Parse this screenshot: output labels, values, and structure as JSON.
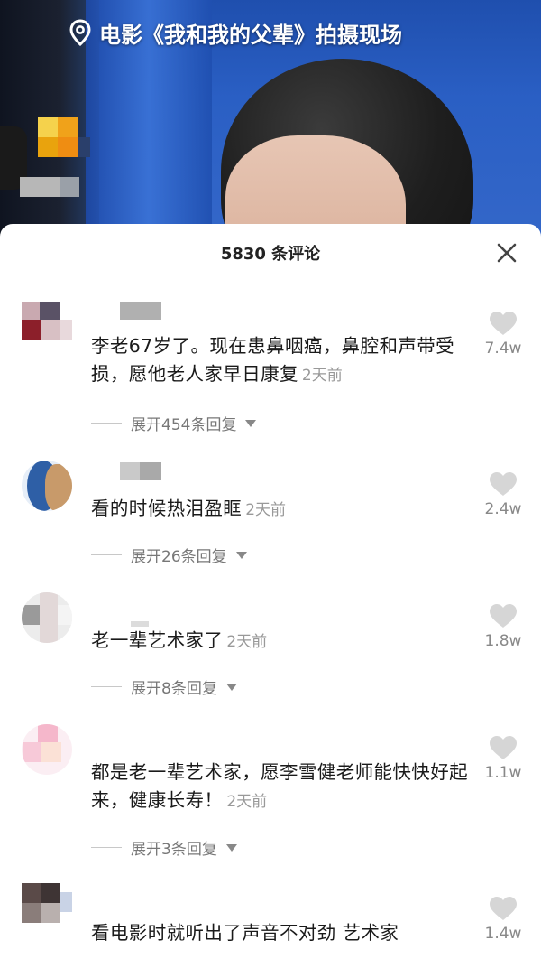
{
  "video": {
    "location_text": "电影《我和我的父辈》拍摄现场"
  },
  "comments_panel": {
    "title": "5830 条评论",
    "close_icon": "close-icon",
    "like_icon": "heart-icon",
    "comments": [
      {
        "text": "李老67岁了。现在患鼻咽癌，鼻腔和声带受损，愿他老人家早日康复",
        "time": "2天前",
        "likes": "7.4w",
        "replies": "展开454条回复"
      },
      {
        "text": "看的时候热泪盈眶",
        "time": "2天前",
        "likes": "2.4w",
        "replies": "展开26条回复"
      },
      {
        "text": "老一辈艺术家了",
        "time": "2天前",
        "likes": "1.8w",
        "replies": "展开8条回复"
      },
      {
        "text": "都是老一辈艺术家，愿李雪健老师能快快好起来，健康长寿！",
        "time": "2天前",
        "likes": "1.1w",
        "replies": "展开3条回复"
      },
      {
        "text": "看电影时就听出了声音不对劲 艺术家",
        "time": "",
        "likes": "1.4w",
        "replies": ""
      }
    ]
  }
}
